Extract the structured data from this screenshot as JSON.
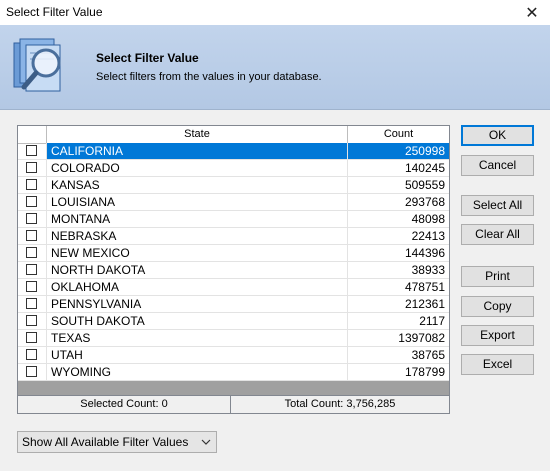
{
  "window": {
    "title": "Select Filter Value"
  },
  "header": {
    "title": "Select Filter Value",
    "subtitle": "Select filters from the values in your database.",
    "icon": "magnifier-documents-icon"
  },
  "grid": {
    "columns": [
      "State",
      "Count"
    ],
    "rows": [
      {
        "state": "CALIFORNIA",
        "count": "250998",
        "selected": true,
        "checked": false
      },
      {
        "state": "COLORADO",
        "count": "140245",
        "selected": false,
        "checked": false
      },
      {
        "state": "KANSAS",
        "count": "509559",
        "selected": false,
        "checked": false
      },
      {
        "state": "LOUISIANA",
        "count": "293768",
        "selected": false,
        "checked": false
      },
      {
        "state": "MONTANA",
        "count": "48098",
        "selected": false,
        "checked": false
      },
      {
        "state": "NEBRASKA",
        "count": "22413",
        "selected": false,
        "checked": false
      },
      {
        "state": "NEW MEXICO",
        "count": "144396",
        "selected": false,
        "checked": false
      },
      {
        "state": "NORTH DAKOTA",
        "count": "38933",
        "selected": false,
        "checked": false
      },
      {
        "state": "OKLAHOMA",
        "count": "478751",
        "selected": false,
        "checked": false
      },
      {
        "state": "PENNSYLVANIA",
        "count": "212361",
        "selected": false,
        "checked": false
      },
      {
        "state": "SOUTH DAKOTA",
        "count": "2117",
        "selected": false,
        "checked": false
      },
      {
        "state": "TEXAS",
        "count": "1397082",
        "selected": false,
        "checked": false
      },
      {
        "state": "UTAH",
        "count": "38765",
        "selected": false,
        "checked": false
      },
      {
        "state": "WYOMING",
        "count": "178799",
        "selected": false,
        "checked": false
      }
    ],
    "footer": {
      "selected_count": "Selected Count: 0",
      "total_count": "Total Count: 3,756,285"
    }
  },
  "buttons": {
    "ok": "OK",
    "cancel": "Cancel",
    "select_all": "Select All",
    "clear_all": "Clear All",
    "print": "Print",
    "copy": "Copy",
    "export": "Export",
    "excel": "Excel"
  },
  "filter_mode": {
    "selected": "Show All Available Filter Values"
  },
  "colors": {
    "selection": "#0078d7",
    "banner": "#b9cde7",
    "default_button_border": "#0078d7"
  }
}
